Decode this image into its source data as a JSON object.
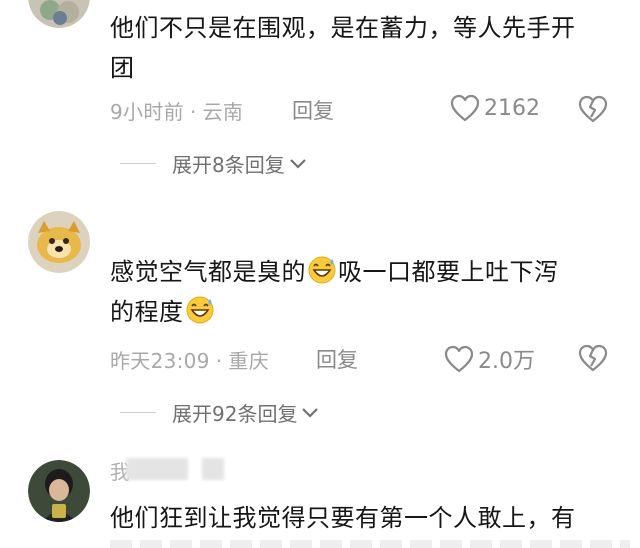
{
  "comments": [
    {
      "text_line1": "他们不只是在围观，是在蓄力，等人先手开",
      "text_line2": "团",
      "time": "9小时前",
      "location": "云南",
      "reply_label": "回复",
      "likes": "2162",
      "expand_label": "展开8条回复"
    },
    {
      "text_part1": "感觉空气都是臭的",
      "text_part2": "吸一口都要上吐下泻",
      "text_part3": "的程度",
      "emoji": "grinning-sweat-emoji",
      "time": "昨天23:09",
      "location": "重庆",
      "reply_label": "回复",
      "likes": "2.0万",
      "expand_label": "展开92条回复"
    },
    {
      "username_visible": "我",
      "text_line1": "他们狂到让我觉得只要有第一个人敢上，有"
    }
  ],
  "separator": "·",
  "colors": {
    "meta": "#a8a8a8",
    "text": "#161616",
    "icon": "#8a8a8a"
  }
}
